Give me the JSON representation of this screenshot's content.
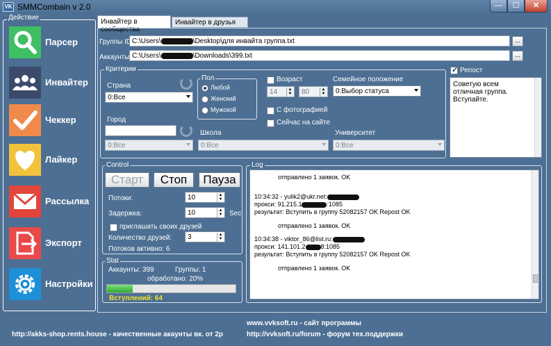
{
  "window": {
    "title": "SMMCombain v 2.0",
    "icon_text": "VK",
    "min_symbol": "—",
    "max_symbol": "☐",
    "close_symbol": "✕"
  },
  "sidebar": {
    "legend": "Действие",
    "items": [
      {
        "label": "Парсер",
        "icon": "search-icon",
        "color": "#3fbf63"
      },
      {
        "label": "Инвайтер",
        "icon": "users-icon",
        "color": "#3b4a6b"
      },
      {
        "label": "Чеккер",
        "icon": "checkmark-icon",
        "color": "#f08a4b"
      },
      {
        "label": "Лайкер",
        "icon": "heart-icon",
        "color": "#f2c23c"
      },
      {
        "label": "Рассылка",
        "icon": "mail-icon",
        "color": "#e2453c"
      },
      {
        "label": "Экспорт",
        "icon": "export-icon",
        "color": "#e84a4a"
      },
      {
        "label": "Настройки",
        "icon": "gear-icon",
        "color": "#1e90d8"
      }
    ]
  },
  "tabs": [
    {
      "label": "Инвайтер в сообщества",
      "active": true
    },
    {
      "label": "Инвайтер в друзья",
      "active": false
    }
  ],
  "files": {
    "groups_label": "Группы ID",
    "groups_prefix": "C:\\Users\\",
    "groups_suffix": "\\Desktop\\для инвайта группа.txt",
    "accounts_label": "Аккаунты",
    "accounts_prefix": "C:\\Users\\",
    "accounts_suffix": "\\Downloads\\399.txt",
    "browse_label": "..."
  },
  "criteria": {
    "legend": "Критерии",
    "country_label": "Страна",
    "country_value": "0:Все",
    "city_label": "Город",
    "city_value": "",
    "city_select_value": "0:Все",
    "gender_legend": "Пол",
    "gender_options": [
      "Любой",
      "Женский",
      "Мужской"
    ],
    "age_label": "Возраст",
    "age_from": "14",
    "age_to": "80",
    "marital_label": "Семейное положение",
    "marital_value": "0:Выбор статуса",
    "with_photo_label": "С фотографией",
    "online_label": "Сейчас на сайте",
    "school_label": "Школа",
    "school_value": "0:Все",
    "university_label": "Университет",
    "university_value": "0:Все"
  },
  "repost": {
    "label": "Репост",
    "checked": true,
    "text_lines": [
      "Советую всем",
      "отличная группа.",
      "Вступайте."
    ]
  },
  "control": {
    "legend": "Control",
    "start_label": "Старт",
    "stop_label": "Стоп",
    "pause_label": "Пауза",
    "threads_label": "Потоки:",
    "threads_value": "10",
    "delay_label": "Задержка:",
    "delay_value": "10",
    "delay_unit": "Sec",
    "invite_friends_label": "приглашать своих друзей",
    "friends_count_label": "Количество друзей:",
    "friends_count_value": "3",
    "active_threads": "Потоков активно: 6"
  },
  "stat": {
    "legend": "Stat",
    "accounts": "Аккаунты: 399",
    "groups": "Группы: 1",
    "processed": "обработано: 20%",
    "progress": 0.2,
    "joined": "Вступлений: 64"
  },
  "log": {
    "legend": "Log",
    "lines": [
      "отправлено 1 заявок. OK",
      "10:34:32 - yulik2@ukr.net:",
      "прокси: 91.215.1",
      ":1085",
      "результат: Вступить в группу 52082157 OK Repost OK",
      "отправлено 1 заявок. OK",
      "10:34:38 - viktor_86@list.ru:",
      "прокси: 141.101.2",
      "8:1085",
      "результат: Вступить в группу 52082157 OK Repost OK",
      "отправлено 1 заявок. OK"
    ]
  },
  "footer": {
    "shop": "http://akks-shop.rents.house - качественные акаунты вк. от 2р",
    "site": "www.vvksoft.ru - сайт программы",
    "forum": "http://vvksoft.ru/forum - форум тех.поддержки"
  }
}
